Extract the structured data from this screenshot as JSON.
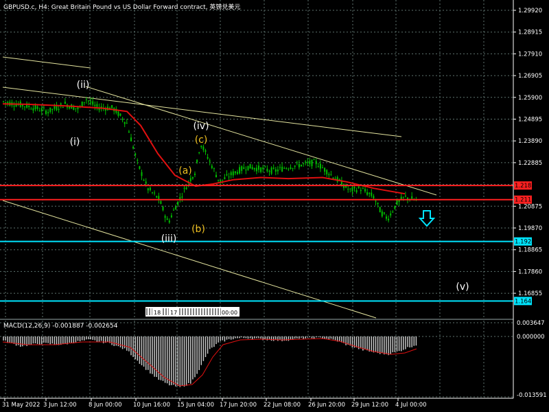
{
  "header": {
    "symbol_info": "GBPUSD.c, H4:  Great Britain Pound vs US Dollar Forward contract, 英镑兑美元"
  },
  "price_axis": {
    "labels": [
      "1.29920",
      "1.28915",
      "1.27910",
      "1.26905",
      "1.25900",
      "1.24895",
      "1.23890",
      "1.22885",
      "1.20875",
      "1.19870",
      "1.18865",
      "1.17860",
      "1.16855"
    ]
  },
  "horizontal_levels": [
    {
      "price_label": "1.21831",
      "color": "#ff2020",
      "label_bg": "#ff2020"
    },
    {
      "price_label": "1.21178",
      "color": "#ff2020",
      "label_bg": "#ff2020"
    },
    {
      "price_label": "1.19248",
      "color": "#00e5ff",
      "label_bg": "#00e5ff"
    },
    {
      "price_label": "1.16498",
      "color": "#00e5ff",
      "label_bg": "#00e5ff"
    }
  ],
  "wave_labels": [
    {
      "text": "(i)",
      "color": "#ffffff"
    },
    {
      "text": "(ii)",
      "color": "#ffffff"
    },
    {
      "text": "(iii)",
      "color": "#ffffff"
    },
    {
      "text": "(iv)",
      "color": "#ffffff"
    },
    {
      "text": "(v)",
      "color": "#ffffff"
    },
    {
      "text": "(a)",
      "color": "#f0c020"
    },
    {
      "text": "(b)",
      "color": "#f0c020"
    },
    {
      "text": "(c)",
      "color": "#f0c020"
    }
  ],
  "scroll_strip": {
    "items": [
      "18",
      "17",
      "00:00"
    ]
  },
  "macd": {
    "title": "MACD(12,26,9) -0.001887 -0.002654",
    "axis_labels": [
      "0.003647",
      "0.000000",
      "-0.013591"
    ]
  },
  "time_axis": {
    "labels": [
      "31 May 2022",
      "3 Jun 12:00",
      "8 Jun 00:00",
      "10 Jun 16:00",
      "15 Jun 04:00",
      "17 Jun 20:00",
      "22 Jun 08:00",
      "26 Jun 20:00",
      "29 Jun 12:00",
      "4 Jul 00:00"
    ]
  },
  "colors": {
    "background": "#000000",
    "grid": "#5f7570",
    "candles": "#00c000",
    "moving_average": "#e01010",
    "trend_lines": "#e6e6a0",
    "macd_hist": "#c8c8c8",
    "macd_signal": "#e01010",
    "axis_text": "#ffffff",
    "arrow": "#00e5ff"
  },
  "icons": {
    "down_arrow": "down-arrow-icon"
  }
}
